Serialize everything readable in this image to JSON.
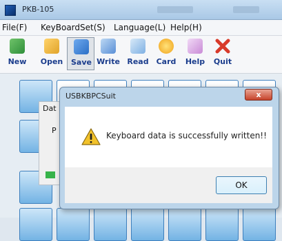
{
  "window": {
    "title": "PKB-105"
  },
  "menubar": {
    "items": [
      {
        "label": "File(F)"
      },
      {
        "label": "KeyBoardSet(S)"
      },
      {
        "label": "Language(L)"
      },
      {
        "label": "Help(H)"
      }
    ]
  },
  "toolbar": {
    "items": [
      {
        "label": "New",
        "icon": "new-icon",
        "color": "#2f8f3a"
      },
      {
        "label": "Open",
        "icon": "open-folder-icon",
        "color": "#e0a329"
      },
      {
        "label": "Save",
        "icon": "save-icon",
        "color": "#2b6fc6"
      },
      {
        "label": "Write",
        "icon": "write-icon",
        "color": "#5a8fd6"
      },
      {
        "label": "Read",
        "icon": "read-icon",
        "color": "#7fb0e3"
      },
      {
        "label": "Card",
        "icon": "card-icon",
        "color": "#f0a21a"
      },
      {
        "label": "Help",
        "icon": "help-icon",
        "color": "#c98bd6"
      },
      {
        "label": "Quit",
        "icon": "quit-icon",
        "color": "#d83a2a"
      }
    ]
  },
  "background_panel": {
    "title": "Dat",
    "text": "P"
  },
  "dialog": {
    "title": "USBKBPCSuit",
    "close_label": "x",
    "icon": "warning-icon",
    "message": "Keyboard data is successfully written!!",
    "ok_label": "OK"
  }
}
